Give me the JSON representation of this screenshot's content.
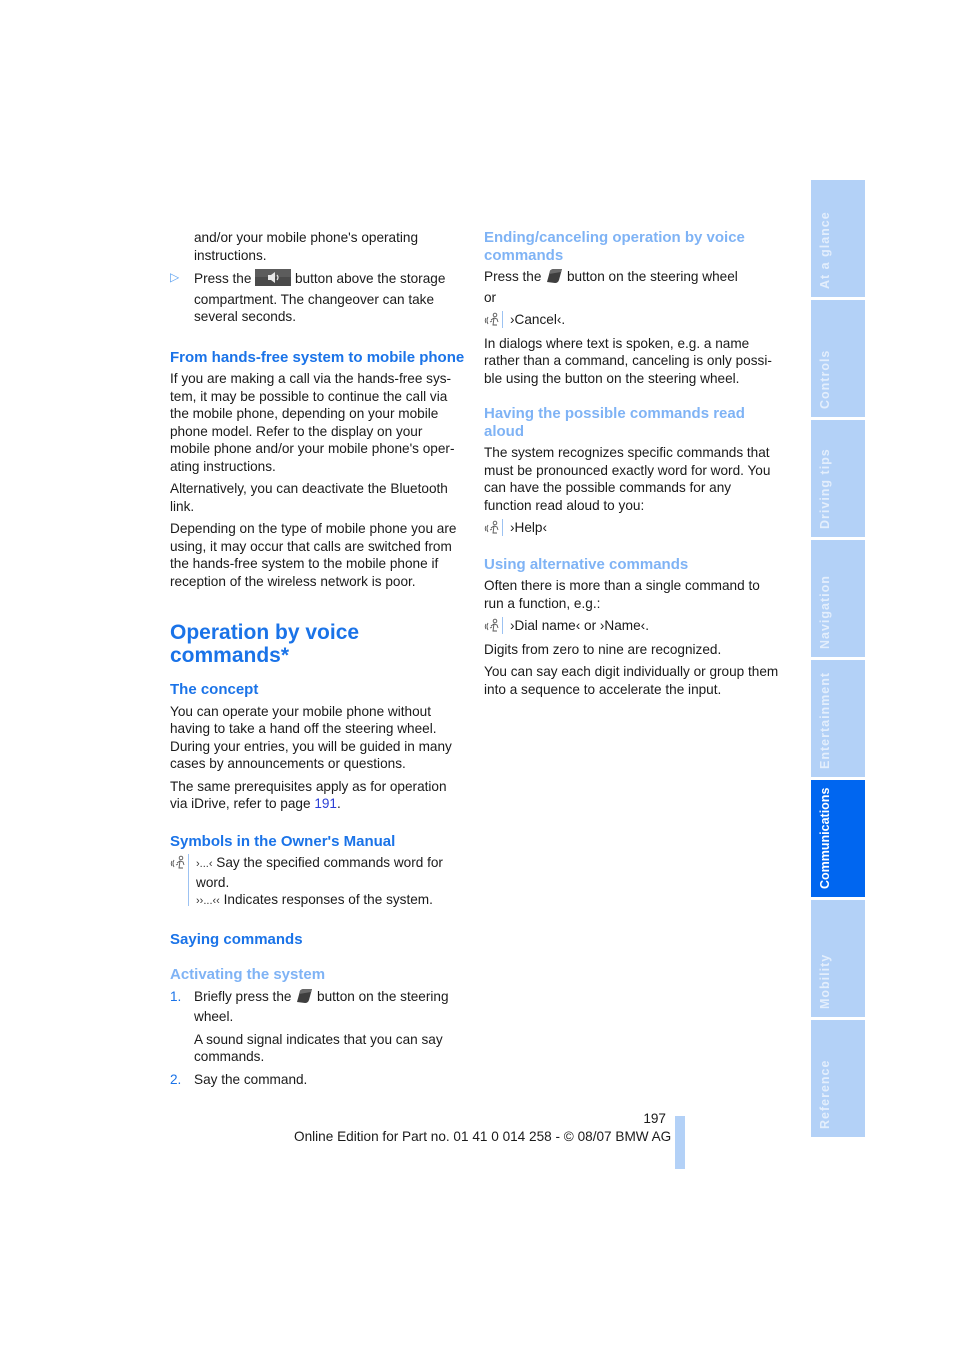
{
  "left_column": {
    "intro_continuation": "and/or your mobile phone's operating instructions.",
    "bullet_press": {
      "before": "Press the",
      "icon": "speaker-button-icon",
      "after": "button above the storage compartment. The changeover can take several seconds."
    },
    "from_handsfree": {
      "heading": "From hands-free system to mobile phone",
      "paragraphs": [
        "If you are making a call via the hands-free sys-tem, it may be possible to continue the call via the mobile phone, depending on your mobile phone model. Refer to the display on your mobile phone and/or your mobile phone's oper-ating instructions.",
        "Alternatively, you can deactivate the Bluetooth link.",
        "Depending on the type of mobile phone you are using, it may occur that calls are switched from the hands-free system to the mobile phone if reception of the wireless network is poor."
      ]
    },
    "section_title": "Operation by voice commands*",
    "concept": {
      "heading": "The concept",
      "paragraph1": "You can operate your mobile phone without having to take a hand off the steering wheel. During your entries, you will be guided in many cases by announcements or questions.",
      "paragraph2_before": "The same prerequisites apply as for operation via iDrive, refer to page",
      "paragraph2_link": "191",
      "paragraph2_after": "."
    },
    "symbols": {
      "heading": "Symbols in the Owner's Manual",
      "icon": "voice-command-icon",
      "line1_marker": "›...‹",
      "line1_text": "Say the specified commands word for word.",
      "line2_marker": "››...‹‹",
      "line2_text": "Indicates responses of the system."
    },
    "saying": {
      "heading": "Saying commands",
      "subheading": "Activating the system",
      "steps": [
        {
          "number": "1.",
          "before": "Briefly press the",
          "icon": "steering-wheel-voice-button-icon",
          "after": "button on the steering wheel.",
          "note": "A sound signal indicates that you can say commands."
        },
        {
          "number": "2.",
          "text": "Say the command."
        }
      ]
    }
  },
  "right_column": {
    "ending": {
      "heading": "Ending/canceling operation by voice commands",
      "press_before": "Press the",
      "press_icon": "steering-wheel-voice-button-icon",
      "press_after": "button on the steering wheel",
      "or": "or",
      "command": "›Cancel‹.",
      "paragraph": "In dialogs where text is spoken, e.g. a name rather than a command, canceling is only possi-ble using the button on the steering wheel."
    },
    "read_aloud": {
      "heading": "Having the possible commands read aloud",
      "paragraph": "The system recognizes specific commands that must be pronounced exactly word for word. You can have the possible commands for any function read aloud to you:",
      "command": "›Help‹"
    },
    "alternative": {
      "heading": "Using alternative commands",
      "paragraph": "Often there is more than a single command to run a function, e.g.:",
      "command": "›Dial name‹ or ›Name‹.",
      "paragraph2": "Digits from zero to nine are recognized.",
      "paragraph3": "You can say each digit individually or group them into a sequence to accelerate the input."
    }
  },
  "footer": {
    "page_number": "197",
    "edition": "Online Edition for Part no. 01 41 0 014 258 - © 08/07 BMW AG"
  },
  "side_tabs": {
    "items": [
      {
        "label": "At a glance",
        "active": false
      },
      {
        "label": "Controls",
        "active": false
      },
      {
        "label": "Driving tips",
        "active": false
      },
      {
        "label": "Navigation",
        "active": false
      },
      {
        "label": "Entertainment",
        "active": false
      },
      {
        "label": "Communications",
        "active": true
      },
      {
        "label": "Mobility",
        "active": false
      },
      {
        "label": "Reference",
        "active": false
      }
    ],
    "colors": {
      "inactive": "#b3d1f7",
      "active": "#0066f0"
    }
  },
  "colors": {
    "heading": "#1a73e8",
    "subheading_light": "#7fb3f5",
    "link": "#2b3fd6",
    "body_text": "#1a1a1a"
  }
}
